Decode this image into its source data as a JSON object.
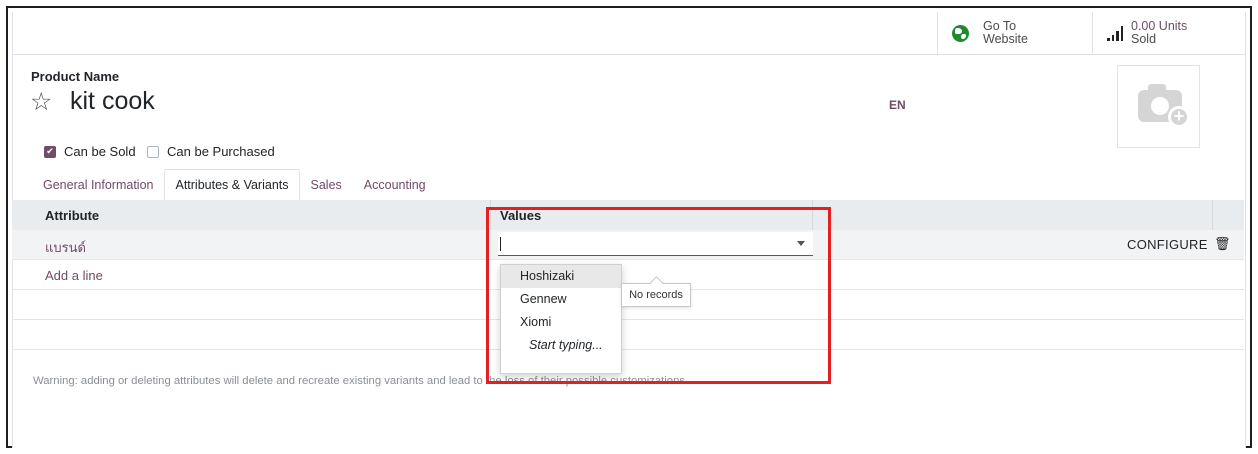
{
  "header_buttons": {
    "website": {
      "line1": "Go To",
      "line2": "Website"
    },
    "units": {
      "value": "0.00 Units",
      "label": "Sold"
    }
  },
  "product": {
    "label": "Product Name",
    "name": "kit cook",
    "lang": "EN"
  },
  "checkboxes": [
    {
      "label": "Can be Sold",
      "checked": true
    },
    {
      "label": "Can be Purchased",
      "checked": false
    }
  ],
  "tabs": [
    {
      "label": "General Information",
      "active": false
    },
    {
      "label": "Attributes & Variants",
      "active": true
    },
    {
      "label": "Sales",
      "active": false
    },
    {
      "label": "Accounting",
      "active": false
    }
  ],
  "grid": {
    "columns": [
      "Attribute",
      "Values"
    ],
    "row": {
      "attribute": "แบรนด์",
      "value": "",
      "configure": "CONFIGURE"
    },
    "add_line": "Add a line"
  },
  "dropdown": {
    "options": [
      "Hoshizaki",
      "Gennew",
      "Xiomi"
    ],
    "start_typing": "Start typing...",
    "highlighted": 0
  },
  "tooltip": "No records",
  "warning": "Warning: adding or deleting attributes will delete and recreate existing variants and lead to the loss of their possible customizations.",
  "colors": {
    "accent": "#714B67",
    "highlight_box": "#e41f1f"
  }
}
